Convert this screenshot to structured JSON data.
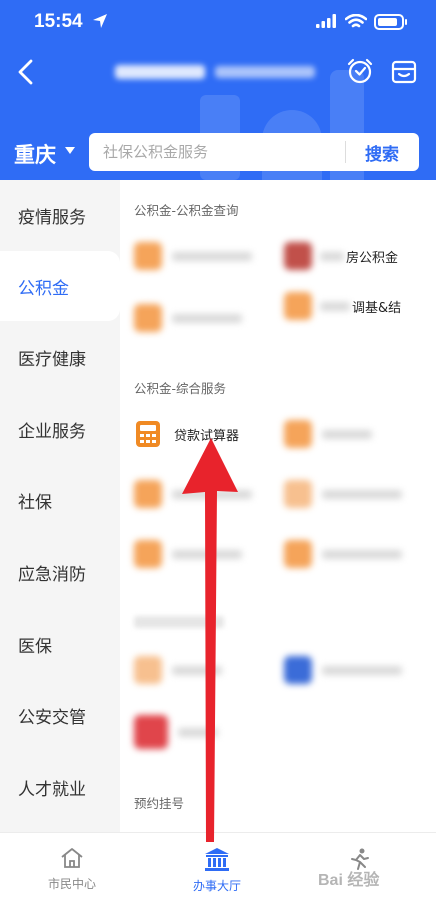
{
  "status_bar": {
    "time": "15:54",
    "battery_level": 0.85
  },
  "header": {
    "city": "重庆",
    "search": {
      "placeholder": "社保公积金服务",
      "button_label": "搜索"
    }
  },
  "sidebar": {
    "items": [
      {
        "label": "疫情服务",
        "active": false
      },
      {
        "label": "公积金",
        "active": true
      },
      {
        "label": "医疗健康",
        "active": false
      },
      {
        "label": "企业服务",
        "active": false
      },
      {
        "label": "社保",
        "active": false
      },
      {
        "label": "应急消防",
        "active": false
      },
      {
        "label": "医保",
        "active": false
      },
      {
        "label": "公安交管",
        "active": false
      },
      {
        "label": "人才就业",
        "active": false
      }
    ]
  },
  "content": {
    "sections": [
      {
        "title": "公积金-公积金查询"
      },
      {
        "title": "公积金-综合服务"
      },
      {
        "title": "预约挂号"
      }
    ],
    "services": {
      "housing_fund": "房公积金",
      "fund_base": "调基&结",
      "loan_calculator": "贷款试算器"
    }
  },
  "tabbar": {
    "tabs": [
      {
        "label": "市民中心",
        "icon": "home-icon"
      },
      {
        "label": "办事大厅",
        "icon": "government-building-icon",
        "active": true
      },
      {
        "label": "",
        "icon": "runner-icon"
      }
    ],
    "watermark": "Bai 经验"
  },
  "colors": {
    "accent": "#2f6cf5",
    "arrow": "#e8232c",
    "service_icon": "#f08a24"
  }
}
